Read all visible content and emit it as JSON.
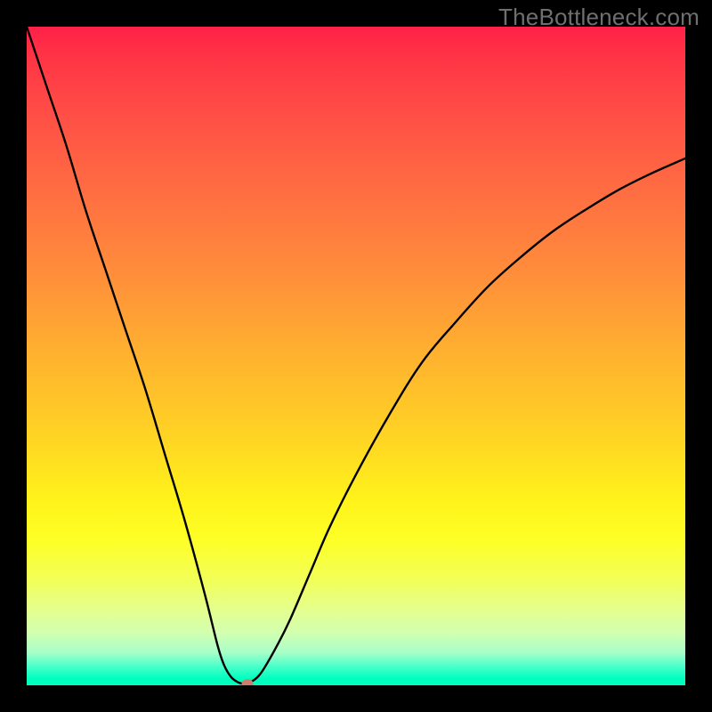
{
  "watermark": "TheBottleneck.com",
  "colors": {
    "black": "#000000",
    "curve": "#000000",
    "marker": "#cd7d6b"
  },
  "chart_data": {
    "type": "line",
    "title": "",
    "xlabel": "",
    "ylabel": "",
    "xlim": [
      0,
      100
    ],
    "ylim": [
      0,
      100
    ],
    "grid": false,
    "legend": false,
    "left_segment": {
      "x": [
        0,
        3,
        6,
        9,
        12,
        15,
        18,
        21,
        24,
        27,
        29,
        30,
        31,
        32,
        33
      ],
      "y": [
        100,
        91,
        82,
        72,
        63,
        54,
        45,
        35,
        25,
        14,
        6,
        3,
        1.3,
        0.5,
        0.2
      ]
    },
    "right_segment": {
      "x": [
        33,
        34,
        35,
        36,
        38,
        40,
        43,
        46,
        50,
        55,
        60,
        65,
        70,
        75,
        80,
        85,
        90,
        95,
        100
      ],
      "y": [
        0.2,
        0.5,
        1.2,
        2.5,
        6,
        10,
        17,
        24,
        32,
        41,
        49,
        55,
        60.5,
        65,
        69,
        72.3,
        75.3,
        77.8,
        80
      ]
    },
    "minimum_marker": {
      "x": 33.5,
      "y": 0.3
    }
  }
}
